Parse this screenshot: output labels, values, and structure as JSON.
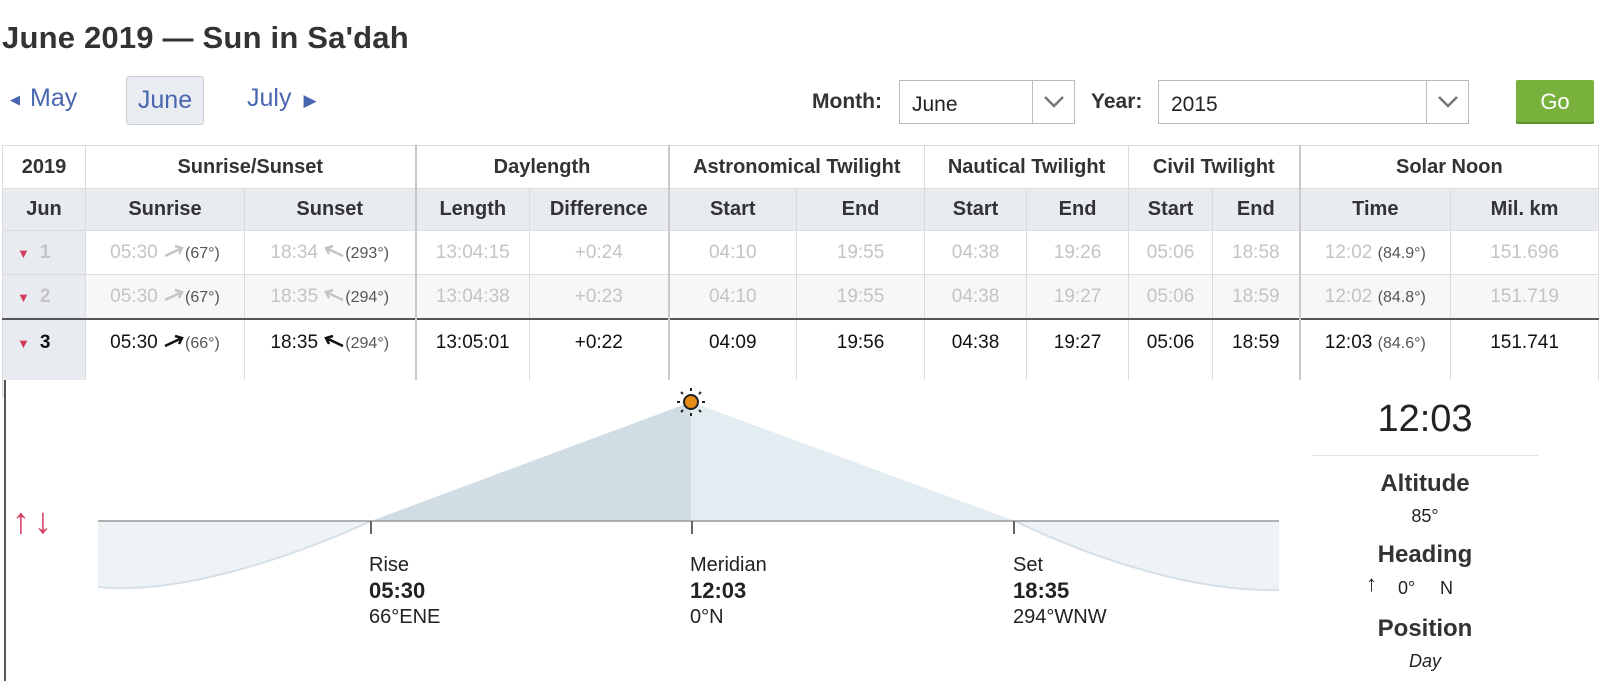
{
  "page_title": "June 2019 — Sun in Sa'dah",
  "nav": {
    "prev_label": "May",
    "current_label": "June",
    "next_label": "July"
  },
  "form": {
    "month_label": "Month:",
    "month_value": "June",
    "year_label": "Year:",
    "year_value": "2015",
    "go_label": "Go"
  },
  "table": {
    "group_headers": [
      "2019",
      "Sunrise/Sunset",
      "Daylength",
      "Astronomical Twilight",
      "Nautical Twilight",
      "Civil Twilight",
      "Solar Noon"
    ],
    "sub_headers": [
      "Jun",
      "Sunrise",
      "Sunset",
      "Length",
      "Difference",
      "Start",
      "End",
      "Start",
      "End",
      "Start",
      "End",
      "Time",
      "Mil. km"
    ],
    "rows": [
      {
        "day": "1",
        "sunrise": "05:30",
        "sunrise_deg": "(67°)",
        "sunset": "18:34",
        "sunset_deg": "(293°)",
        "length": "13:04:15",
        "diff": "+0:24",
        "astro_start": "04:10",
        "astro_end": "19:55",
        "naut_start": "04:38",
        "naut_end": "19:26",
        "civil_start": "05:06",
        "civil_end": "18:58",
        "noon": "12:02",
        "noon_deg": "(84.9°)",
        "dist": "151.696"
      },
      {
        "day": "2",
        "sunrise": "05:30",
        "sunrise_deg": "(67°)",
        "sunset": "18:35",
        "sunset_deg": "(294°)",
        "length": "13:04:38",
        "diff": "+0:23",
        "astro_start": "04:10",
        "astro_end": "19:55",
        "naut_start": "04:38",
        "naut_end": "19:27",
        "civil_start": "05:06",
        "civil_end": "18:59",
        "noon": "12:02",
        "noon_deg": "(84.8°)",
        "dist": "151.719"
      },
      {
        "day": "3",
        "sunrise": "05:30",
        "sunrise_deg": "(66°)",
        "sunset": "18:35",
        "sunset_deg": "(294°)",
        "length": "13:05:01",
        "diff": "+0:22",
        "astro_start": "04:09",
        "astro_end": "19:56",
        "naut_start": "04:38",
        "naut_end": "19:27",
        "civil_start": "05:06",
        "civil_end": "18:59",
        "noon": "12:03",
        "noon_deg": "(84.6°)",
        "dist": "151.741"
      }
    ]
  },
  "panel": {
    "rise": {
      "label": "Rise",
      "time": "05:30",
      "dir": "66°ENE"
    },
    "meridian": {
      "label": "Meridian",
      "time": "12:03",
      "dir": "0°N"
    },
    "set": {
      "label": "Set",
      "time": "18:35",
      "dir": "294°WNW"
    },
    "info": {
      "time": "12:03",
      "altitude_label": "Altitude",
      "altitude_value": "85°",
      "heading_label": "Heading",
      "heading_deg": "0°",
      "heading_dir": "N",
      "position_label": "Position",
      "position_value": "Day"
    }
  },
  "colors": {
    "link": "#4a66b0",
    "go_button": "#78b13b",
    "accent_red": "#d23c5d",
    "header_bg": "#e8ecf1"
  }
}
